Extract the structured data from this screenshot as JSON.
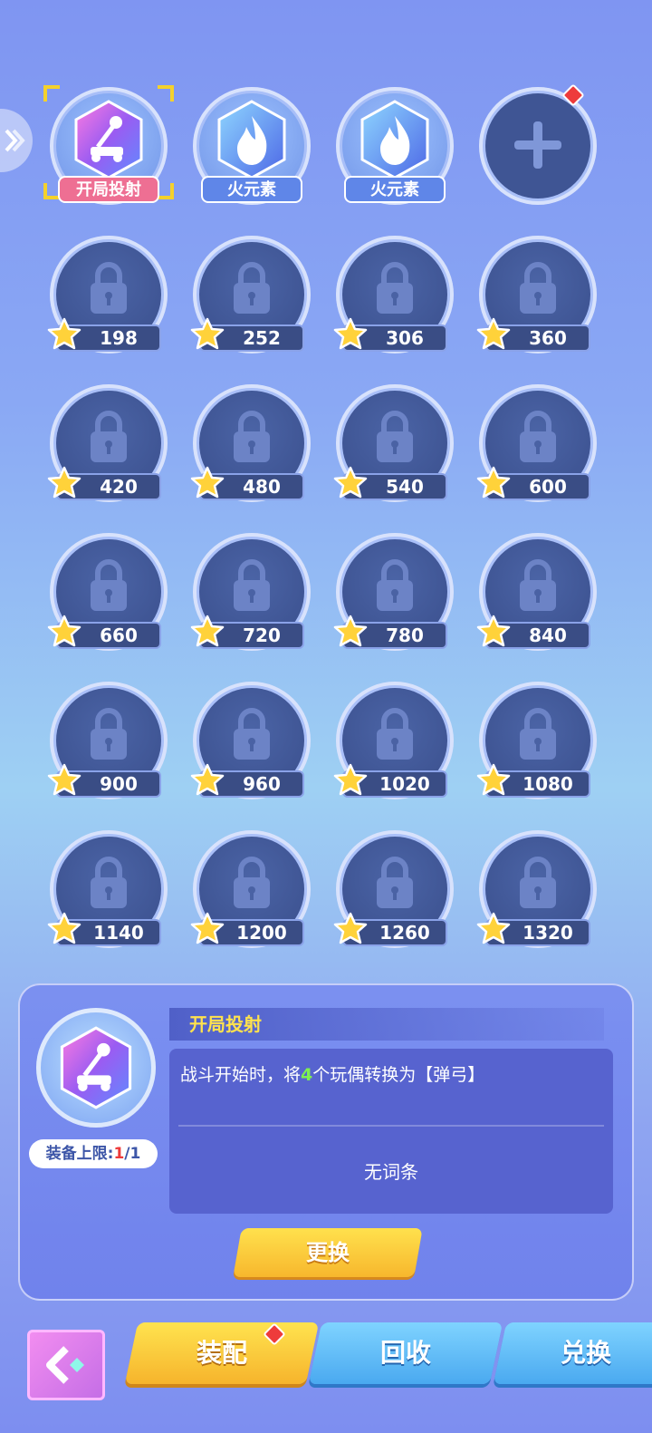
{
  "equipped": [
    {
      "label": "开局投射",
      "icon": "catapult-icon",
      "style": "pink",
      "selected": true
    },
    {
      "label": "火元素",
      "icon": "fire-icon",
      "style": "blue",
      "selected": false
    },
    {
      "label": "火元素",
      "icon": "fire-icon",
      "style": "blue",
      "selected": false
    }
  ],
  "locked_slots": [
    "198",
    "252",
    "306",
    "360",
    "420",
    "480",
    "540",
    "600",
    "660",
    "720",
    "780",
    "840",
    "900",
    "960",
    "1020",
    "1080",
    "1140",
    "1200",
    "1260",
    "1320"
  ],
  "detail": {
    "title": "开局投射",
    "desc_prefix": "战斗开始时，将",
    "desc_highlight": "4",
    "desc_suffix": "个玩偶转换为【弹弓】",
    "no_entry": "无词条",
    "limit_label": "装备上限:",
    "limit_current": "1",
    "limit_max": "/1",
    "change_button": "更换"
  },
  "nav": {
    "equip": "装配",
    "recycle": "回收",
    "exchange": "兑换"
  },
  "colors": {
    "highlight": "#7df04f",
    "title": "#ffe24d",
    "tab_active": "#f6b42c",
    "tab_inactive": "#4aa9f0"
  }
}
